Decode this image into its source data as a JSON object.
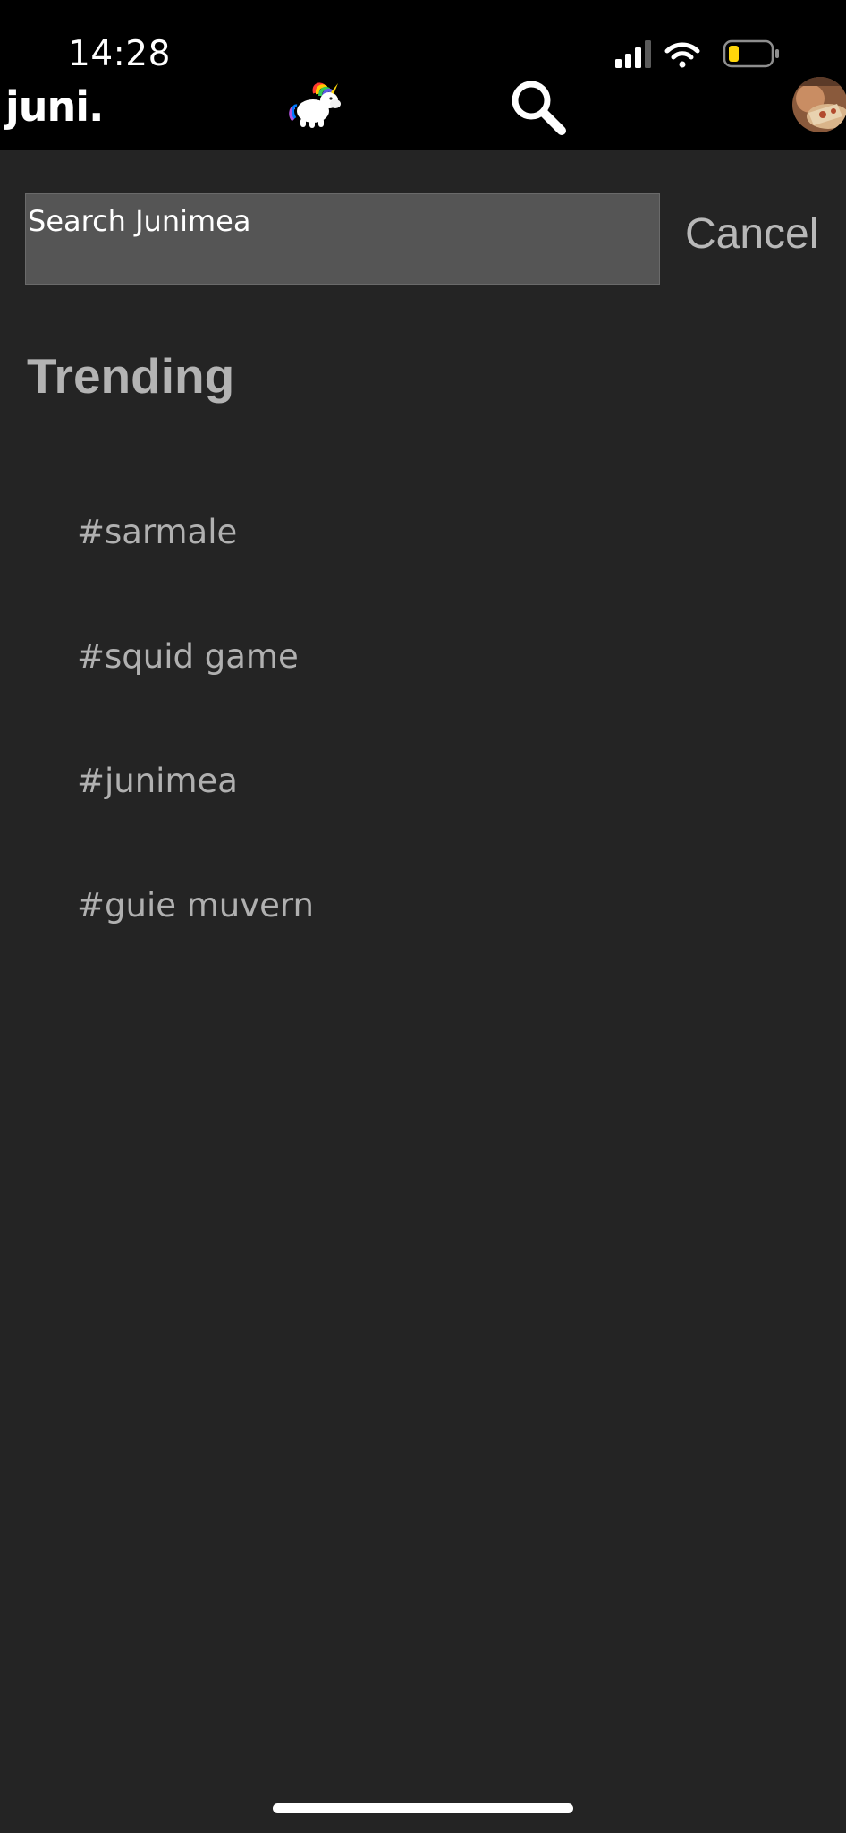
{
  "status_bar": {
    "time": "14:28"
  },
  "header": {
    "brand": "juni.",
    "icons": [
      "unicorn-logo-icon",
      "search-icon",
      "avatar"
    ]
  },
  "search": {
    "placeholder": "Search Junimea",
    "cancel_label": "Cancel"
  },
  "trending": {
    "title": "Trending",
    "tags": [
      "#sarmale",
      "#squid game",
      "#junimea",
      "#guie muvern"
    ]
  },
  "colors": {
    "background": "#242424",
    "header": "#000000",
    "input_bg": "#555555",
    "text_muted": "#b3b3b3",
    "battery_low": "#ffd60a"
  }
}
